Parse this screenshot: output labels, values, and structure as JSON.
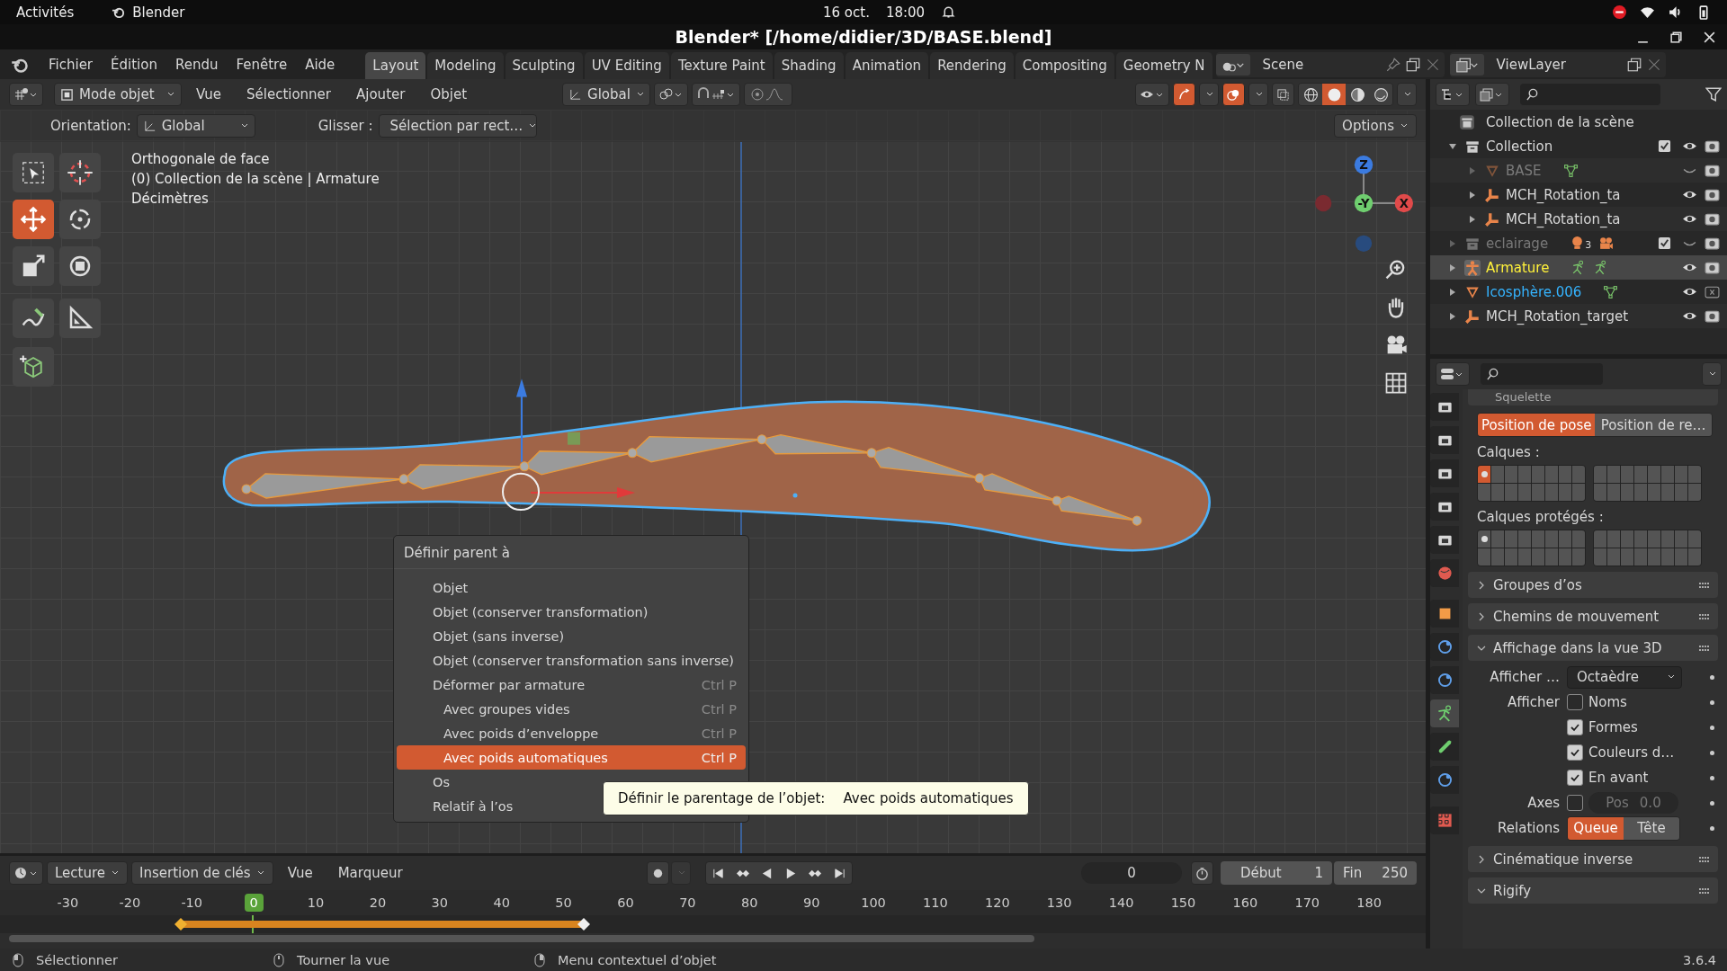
{
  "system_bar": {
    "activities": "Activités",
    "app": "Blender",
    "date": "16 oct.",
    "time": "18:00"
  },
  "window": {
    "title": "Blender* [/home/didier/3D/BASE.blend]"
  },
  "menu": [
    "Fichier",
    "Édition",
    "Rendu",
    "Fenêtre",
    "Aide"
  ],
  "workspaces": [
    {
      "label": "Layout",
      "selected": true
    },
    {
      "label": "Modeling",
      "selected": false
    },
    {
      "label": "Sculpting",
      "selected": false
    },
    {
      "label": "UV Editing",
      "selected": false
    },
    {
      "label": "Texture Paint",
      "selected": false
    },
    {
      "label": "Shading",
      "selected": false
    },
    {
      "label": "Animation",
      "selected": false
    },
    {
      "label": "Rendering",
      "selected": false
    },
    {
      "label": "Compositing",
      "selected": false
    },
    {
      "label": "Geometry N",
      "selected": false
    }
  ],
  "scene": "Scene",
  "view_layer": "ViewLayer",
  "viewport": {
    "mode": "Mode objet",
    "menus": [
      "Vue",
      "Sélectionner",
      "Ajouter",
      "Objet"
    ],
    "transform_orientation": "Global",
    "snap_on": false,
    "proportional_on": false,
    "gizmos_on": true,
    "overlays_on": true,
    "xray_on": false,
    "shading": [
      {
        "kind": "wireframe",
        "selected": false
      },
      {
        "kind": "solid",
        "selected": true
      },
      {
        "kind": "material",
        "selected": false
      },
      {
        "kind": "rendered",
        "selected": false
      }
    ],
    "orientation_label": "Orientation:",
    "orientation": "Global",
    "drag_label": "Glisser :",
    "drag": "Sélection par rect…",
    "options": "Options",
    "info": [
      "Orthogonale de face",
      "(0) Collection de la scène | Armature",
      "Décimètres"
    ],
    "axes": {
      "z": "Z",
      "y": "-Y",
      "x": "X"
    },
    "tools": [
      {
        "kind": "select",
        "selected": false
      },
      {
        "kind": "cursor",
        "selected": false
      },
      {
        "kind": "move",
        "selected": true
      },
      {
        "kind": "rotate",
        "selected": false
      },
      {
        "kind": "scale",
        "selected": false
      },
      {
        "kind": "transform",
        "selected": false
      },
      {
        "kind": "annotate",
        "selected": false
      },
      {
        "kind": "measure",
        "selected": false
      },
      {
        "kind": "add-cube",
        "selected": false
      }
    ]
  },
  "context_menu": {
    "title": "Définir parent à",
    "items": [
      {
        "label": "Objet",
        "selected": false
      },
      {
        "label": "Objet (conserver transformation)",
        "selected": false
      },
      {
        "label": "Objet (sans inverse)",
        "selected": false
      },
      {
        "label": "Objet (conserver transformation sans inverse)",
        "selected": false
      },
      {
        "label": "Déformer par armature",
        "shortcut": "Ctrl P",
        "selected": false,
        "children": [
          {
            "label": "Avec groupes vides",
            "shortcut": "Ctrl P",
            "selected": false
          },
          {
            "label": "Avec poids d’enveloppe",
            "shortcut": "Ctrl P",
            "selected": false
          },
          {
            "label": "Avec poids automatiques",
            "shortcut": "Ctrl P",
            "selected": true
          }
        ]
      },
      {
        "label": "Os",
        "selected": false
      },
      {
        "label": "Relatif à l’os",
        "selected": false
      }
    ]
  },
  "tooltip": {
    "label": "Définir le parentage de l’objet:",
    "value": "Avec poids automatiques"
  },
  "outliner": {
    "root": "Collection de la scène",
    "items": [
      {
        "name": "Collection",
        "kind": "collection",
        "expanded": true,
        "checked": true,
        "active": false,
        "selected": false,
        "hidden": false,
        "visible": true,
        "renderable": true,
        "children": [
          {
            "name": "BASE",
            "kind": "mesh",
            "expanded": false,
            "active": false,
            "selected": false,
            "hidden": true,
            "visible": false,
            "renderable": true,
            "data_icons": [
              {
                "kind": "mesh-data"
              }
            ]
          },
          {
            "name": "MCH_Rotation_ta",
            "kind": "empty",
            "expanded": false,
            "active": false,
            "selected": false,
            "hidden": false,
            "visible": true,
            "renderable": true
          },
          {
            "name": "MCH_Rotation_ta",
            "kind": "empty",
            "expanded": false,
            "active": false,
            "selected": false,
            "hidden": false,
            "visible": true,
            "renderable": true
          }
        ]
      },
      {
        "name": "eclairage",
        "kind": "collection",
        "expanded": false,
        "checked": true,
        "active": false,
        "selected": false,
        "hidden": true,
        "visible": false,
        "renderable": true,
        "data_icons": [
          {
            "kind": "light",
            "count": "3"
          },
          {
            "kind": "camera"
          }
        ]
      },
      {
        "name": "Armature",
        "kind": "armature",
        "expanded": false,
        "active": true,
        "selected": true,
        "hidden": false,
        "visible": true,
        "renderable": true,
        "data_icons": [
          {
            "kind": "pose"
          },
          {
            "kind": "pose"
          }
        ]
      },
      {
        "name": "Icosphère.006",
        "kind": "mesh",
        "expanded": false,
        "active": false,
        "selected": true,
        "hidden": false,
        "visible": true,
        "renderable": false,
        "data_icons": [
          {
            "kind": "mesh-data"
          }
        ]
      },
      {
        "name": "MCH_Rotation_target",
        "kind": "empty",
        "expanded": false,
        "active": false,
        "selected": false,
        "hidden": false,
        "visible": true,
        "renderable": true
      }
    ]
  },
  "properties": {
    "tabs": [
      {
        "kind": "tool",
        "selected": false
      },
      {
        "kind": "render",
        "selected": false
      },
      {
        "kind": "output",
        "selected": false
      },
      {
        "kind": "view-layer",
        "selected": false
      },
      {
        "kind": "scene",
        "selected": false
      },
      {
        "kind": "world",
        "selected": false
      },
      {
        "kind": "object",
        "selected": false
      },
      {
        "kind": "physics",
        "selected": false
      },
      {
        "kind": "constraints",
        "selected": false
      },
      {
        "kind": "armature",
        "selected": true
      },
      {
        "kind": "bone",
        "selected": false
      },
      {
        "kind": "bone-constraints",
        "selected": false
      },
      {
        "kind": "texture",
        "selected": false
      }
    ],
    "section_title": "Squelette",
    "pose": [
      {
        "label": "Position de pose",
        "selected": true
      },
      {
        "label": "Position de re…",
        "selected": false
      }
    ],
    "layer_sets": [
      {
        "label": "Calques :",
        "blocks": [
          {
            "cells": [
              {
                "selected": true,
                "used": true
              },
              {
                "selected": false,
                "used": false
              },
              {
                "selected": false,
                "used": false
              },
              {
                "selected": false,
                "used": false
              },
              {
                "selected": false,
                "used": false
              },
              {
                "selected": false,
                "used": false
              },
              {
                "selected": false,
                "used": false
              },
              {
                "selected": false,
                "used": false
              },
              {
                "selected": false,
                "used": false
              },
              {
                "selected": false,
                "used": false
              },
              {
                "selected": false,
                "used": false
              },
              {
                "selected": false,
                "used": false
              },
              {
                "selected": false,
                "used": false
              },
              {
                "selected": false,
                "used": false
              },
              {
                "selected": false,
                "used": false
              },
              {
                "selected": false,
                "used": false
              }
            ]
          },
          {
            "cells": [
              {
                "selected": false,
                "used": false
              },
              {
                "selected": false,
                "used": false
              },
              {
                "selected": false,
                "used": false
              },
              {
                "selected": false,
                "used": false
              },
              {
                "selected": false,
                "used": false
              },
              {
                "selected": false,
                "used": false
              },
              {
                "selected": false,
                "used": false
              },
              {
                "selected": false,
                "used": false
              },
              {
                "selected": false,
                "used": false
              },
              {
                "selected": false,
                "used": false
              },
              {
                "selected": false,
                "used": false
              },
              {
                "selected": false,
                "used": false
              },
              {
                "selected": false,
                "used": false
              },
              {
                "selected": false,
                "used": false
              },
              {
                "selected": false,
                "used": false
              },
              {
                "selected": false,
                "used": false
              }
            ]
          }
        ]
      },
      {
        "label": "Calques protégés :",
        "blocks": [
          {
            "cells": [
              {
                "selected": false,
                "used": true
              },
              {
                "selected": false,
                "used": false
              },
              {
                "selected": false,
                "used": false
              },
              {
                "selected": false,
                "used": false
              },
              {
                "selected": false,
                "used": false
              },
              {
                "selected": false,
                "used": false
              },
              {
                "selected": false,
                "used": false
              },
              {
                "selected": false,
                "used": false
              },
              {
                "selected": false,
                "used": false
              },
              {
                "selected": false,
                "used": false
              },
              {
                "selected": false,
                "used": false
              },
              {
                "selected": false,
                "used": false
              },
              {
                "selected": false,
                "used": false
              },
              {
                "selected": false,
                "used": false
              },
              {
                "selected": false,
                "used": false
              },
              {
                "selected": false,
                "used": false
              }
            ]
          },
          {
            "cells": [
              {
                "selected": false,
                "used": false
              },
              {
                "selected": false,
                "used": false
              },
              {
                "selected": false,
                "used": false
              },
              {
                "selected": false,
                "used": false
              },
              {
                "selected": false,
                "used": false
              },
              {
                "selected": false,
                "used": false
              },
              {
                "selected": false,
                "used": false
              },
              {
                "selected": false,
                "used": false
              },
              {
                "selected": false,
                "used": false
              },
              {
                "selected": false,
                "used": false
              },
              {
                "selected": false,
                "used": false
              },
              {
                "selected": false,
                "used": false
              },
              {
                "selected": false,
                "used": false
              },
              {
                "selected": false,
                "used": false
              },
              {
                "selected": false,
                "used": false
              },
              {
                "selected": false,
                "used": false
              }
            ]
          }
        ]
      }
    ],
    "panels": [
      {
        "title": "Groupes d’os",
        "expanded": false
      },
      {
        "title": "Chemins de mouvement",
        "expanded": false
      },
      {
        "title": "Affichage dans la vue 3D",
        "expanded": true,
        "rows": [
          {
            "kind": "dropdown",
            "label": "Afficher …",
            "value": "Octaèdre"
          },
          {
            "kind": "checkbox",
            "label": "Afficher",
            "text": "Noms",
            "checked": false
          },
          {
            "kind": "checkbox",
            "text": "Formes",
            "checked": true
          },
          {
            "kind": "checkbox",
            "text": "Couleurs d…",
            "checked": true
          },
          {
            "kind": "checkbox",
            "text": "En avant",
            "checked": true
          },
          {
            "kind": "axes",
            "label": "Axes",
            "checked": false,
            "field_label": "Pos",
            "field_value": "0.0"
          },
          {
            "kind": "toggle",
            "label": "Relations",
            "options": [
              {
                "label": "Queue",
                "selected": true
              },
              {
                "label": "Tête",
                "selected": false
              }
            ]
          }
        ]
      },
      {
        "title": "Cinématique inverse",
        "expanded": false
      },
      {
        "title": "Rigify",
        "expanded": true
      }
    ]
  },
  "timeline": {
    "playback": "Lecture",
    "keying": "Insertion de clés",
    "menus": [
      "Vue",
      "Marqueur"
    ],
    "frame": "0",
    "start_label": "Début",
    "start": "1",
    "end_label": "Fin",
    "end": "250",
    "ruler": [
      {
        "label": "-30",
        "current": false
      },
      {
        "label": "-20",
        "current": false
      },
      {
        "label": "-10",
        "current": false
      },
      {
        "label": "0",
        "current": true
      },
      {
        "label": "10",
        "current": false
      },
      {
        "label": "20",
        "current": false
      },
      {
        "label": "30",
        "current": false
      },
      {
        "label": "40",
        "current": false
      },
      {
        "label": "50",
        "current": false
      },
      {
        "label": "60",
        "current": false
      },
      {
        "label": "70",
        "current": false
      },
      {
        "label": "80",
        "current": false
      },
      {
        "label": "90",
        "current": false
      },
      {
        "label": "100",
        "current": false
      },
      {
        "label": "110",
        "current": false
      },
      {
        "label": "120",
        "current": false
      },
      {
        "label": "130",
        "current": false
      },
      {
        "label": "140",
        "current": false
      },
      {
        "label": "150",
        "current": false
      },
      {
        "label": "160",
        "current": false
      },
      {
        "label": "170",
        "current": false
      },
      {
        "label": "180",
        "current": false
      }
    ]
  },
  "status_bar": {
    "items": [
      {
        "kind": "mouse-left",
        "label": "Sélectionner"
      },
      {
        "kind": "mouse-middle",
        "label": "Tourner la vue"
      },
      {
        "kind": "mouse-right",
        "label": "Menu contextuel d’objet"
      }
    ],
    "version": "3.6.4"
  }
}
